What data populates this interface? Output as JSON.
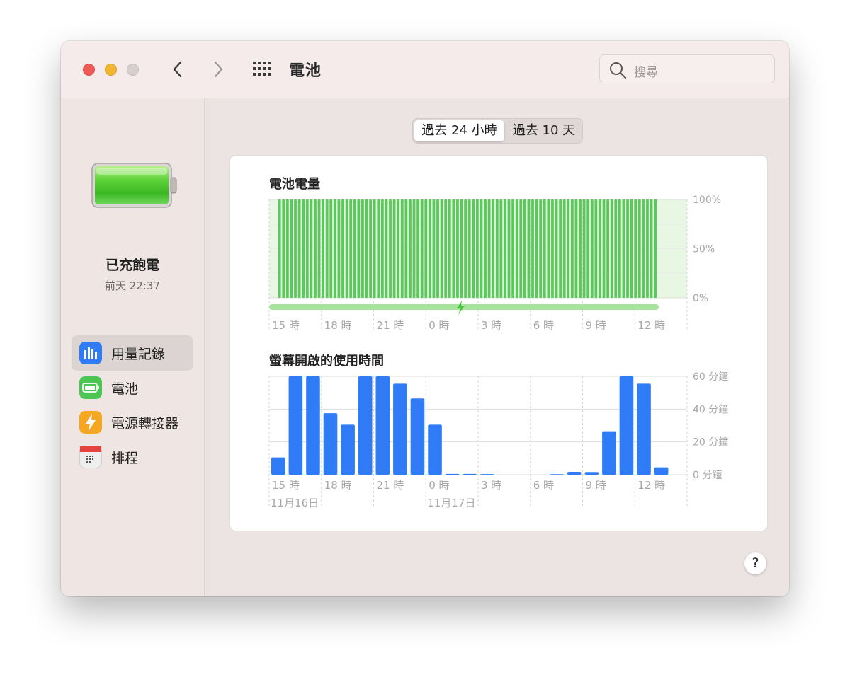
{
  "window": {
    "title": "電池"
  },
  "search": {
    "placeholder": "搜尋"
  },
  "sidebar": {
    "status": {
      "title": "已充飽電",
      "time": "前天 22:37"
    },
    "items": [
      {
        "label": "用量記錄",
        "icon": "bar-chart-icon",
        "active": true,
        "color": "#2f7cf6"
      },
      {
        "label": "電池",
        "icon": "battery-icon",
        "active": false,
        "color": "#4cc552"
      },
      {
        "label": "電源轉接器",
        "icon": "bolt-icon",
        "active": false,
        "color": "#f5a623"
      },
      {
        "label": "排程",
        "icon": "calendar-icon",
        "active": false,
        "color": "#e8e8e8"
      }
    ]
  },
  "range": {
    "options": [
      "過去 24 小時",
      "過去 10 天"
    ],
    "selected": 0
  },
  "help": {
    "label": "?"
  },
  "chart_data": [
    {
      "type": "bar",
      "title": "電池電量",
      "color": "#5ac85a",
      "yticks": [
        "100%",
        "50%",
        "0%"
      ],
      "ylim": [
        0,
        100
      ],
      "xticks": [
        "15 時",
        "18 時",
        "21 時",
        "0 時",
        "3 時",
        "6 時",
        "9 時",
        "12 時"
      ],
      "values": [
        100,
        100,
        100,
        100,
        100,
        100,
        100,
        100,
        100,
        100,
        100,
        100,
        100,
        100,
        100,
        100,
        100,
        100,
        100,
        100,
        100,
        100,
        100,
        100,
        100,
        100,
        100,
        100,
        100,
        100,
        100,
        100,
        100,
        100,
        100,
        100,
        100,
        100,
        100,
        100,
        100,
        100,
        100,
        100,
        100,
        100,
        100,
        100,
        100,
        100,
        100,
        100,
        100,
        100,
        100,
        100,
        100,
        100,
        100,
        100,
        100,
        100,
        100,
        100,
        100,
        100,
        100,
        100,
        100,
        100,
        100,
        100,
        100,
        100,
        100,
        100,
        100,
        100,
        100,
        100,
        100,
        100,
        100,
        100,
        100,
        100,
        100,
        100,
        100,
        100,
        100,
        100,
        100,
        100,
        100,
        100
      ],
      "charging": true
    },
    {
      "type": "bar",
      "title": "螢幕開啟的使用時間",
      "color": "#2f7cf6",
      "yticks": [
        "60 分鐘",
        "40 分鐘",
        "20 分鐘",
        "0 分鐘"
      ],
      "ylim": [
        0,
        60
      ],
      "xticks": [
        "15 時",
        "18 時",
        "21 時",
        "0 時",
        "3 時",
        "6 時",
        "9 時",
        "12 時"
      ],
      "dates": [
        "11月16日",
        "11月17日"
      ],
      "values": [
        10.5,
        60,
        60,
        37.5,
        30.5,
        60,
        60,
        55.5,
        46.5,
        30.5,
        0.5,
        0.5,
        0.4,
        0,
        0,
        0,
        0.3,
        1.7,
        1.6,
        26.5,
        60,
        55.5,
        4.5
      ]
    }
  ]
}
